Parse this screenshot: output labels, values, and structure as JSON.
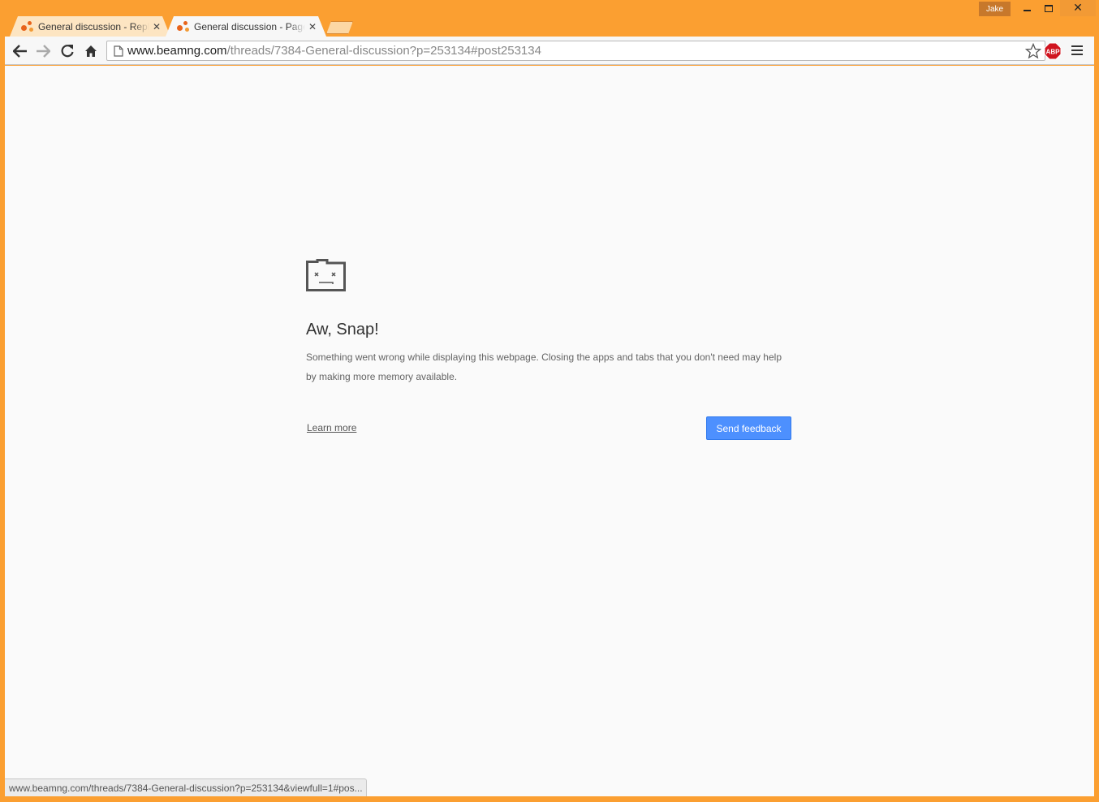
{
  "window": {
    "profile_name": "Jake",
    "controls": [
      "minimize",
      "maximize",
      "close"
    ]
  },
  "tabs": [
    {
      "title": "General discussion - Reply",
      "icon": "beamng-favicon",
      "close_glyph": "✕",
      "active": false
    },
    {
      "title": "General discussion - Page",
      "icon": "beamng-favicon",
      "close_glyph": "✕",
      "active": true
    }
  ],
  "toolbar": {
    "url_host": "www.beamng.com",
    "url_path": "/threads/7384-General-discussion?p=253134#post253134",
    "extension_label": "ABP"
  },
  "error_page": {
    "title": "Aw, Snap!",
    "message": "Something went wrong while displaying this webpage. Closing the apps and tabs that you don't need may help by making more memory available.",
    "learn_more": "Learn more",
    "send_feedback": "Send feedback"
  },
  "status_bar": {
    "text": "www.beamng.com/threads/7384-General-discussion?p=253134&viewfull=1#pos..."
  },
  "colors": {
    "frame": "#fb9f31",
    "button_blue": "#4d90fe",
    "favicon": "#e8641b",
    "abp_red": "#d0141f"
  }
}
